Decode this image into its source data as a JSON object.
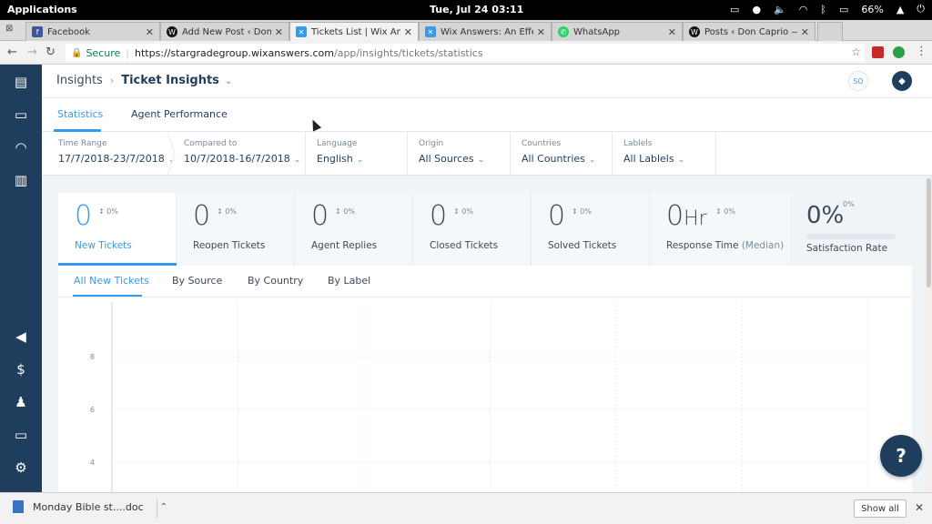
{
  "os": {
    "apps_label": "Applications",
    "clock": "Tue, Jul 24   03:11",
    "battery": "66%"
  },
  "browser": {
    "tabs": [
      {
        "title": "Facebook",
        "icon": "facebook-icon",
        "color": "#3b5998"
      },
      {
        "title": "Add New Post ‹ Don Cap",
        "icon": "wordpress-icon",
        "color": "#111111"
      },
      {
        "title": "Tickets List | Wix Answe",
        "icon": "wix-answers-icon",
        "color": "#3899ec"
      },
      {
        "title": "Wix Answers: An Effecti",
        "icon": "wix-answers-icon",
        "color": "#3899ec"
      },
      {
        "title": "WhatsApp",
        "icon": "whatsapp-icon",
        "color": "#25d366"
      },
      {
        "title": "Posts ‹ Don Caprio — W",
        "icon": "wordpress-icon",
        "color": "#111111"
      }
    ],
    "secure_label": "Secure",
    "url_host": "https://stargradegroup.wixanswers.com",
    "url_path": "/app/insights/tickets/statistics"
  },
  "header": {
    "breadcrumb_root": "Insights",
    "breadcrumb_current": "Ticket Insights",
    "avatar_initials": "SO"
  },
  "tabs": {
    "statistics": "Statistics",
    "agent_performance": "Agent Performance"
  },
  "filters": [
    {
      "label": "Time Range",
      "value": "17/7/2018-23/7/2018"
    },
    {
      "label": "Compared to",
      "value": "10/7/2018-16/7/2018"
    },
    {
      "label": "Language",
      "value": "English"
    },
    {
      "label": "Origin",
      "value": "All Sources"
    },
    {
      "label": "Countries",
      "value": "All Countries"
    },
    {
      "label": "Lablels",
      "value": "All Lablels"
    }
  ],
  "stats": [
    {
      "value": "0",
      "unit": "",
      "change": "0%",
      "label": "New Tickets",
      "sub": ""
    },
    {
      "value": "0",
      "unit": "",
      "change": "0%",
      "label": "Reopen Tickets",
      "sub": ""
    },
    {
      "value": "0",
      "unit": "",
      "change": "0%",
      "label": "Agent Replies",
      "sub": ""
    },
    {
      "value": "0",
      "unit": "",
      "change": "0%",
      "label": "Closed Tickets",
      "sub": ""
    },
    {
      "value": "0",
      "unit": "",
      "change": "0%",
      "label": "Solved Tickets",
      "sub": ""
    },
    {
      "value": "0",
      "unit": "Hr",
      "change": "0%",
      "label": "Response Time",
      "sub": "(Median)"
    }
  ],
  "satisfaction": {
    "value": "0%",
    "change": "0%",
    "label": "Satisfaction Rate",
    "fill_fraction": 0
  },
  "chart_tabs": [
    "All New Tickets",
    "By Source",
    "By Country",
    "By Label"
  ],
  "chart_data": {
    "type": "line",
    "title": "",
    "yticks_visible": [
      8,
      6,
      4
    ],
    "series": []
  },
  "help_label": "?",
  "downloads": {
    "item": "Monday  Bible st....doc",
    "show_all": "Show all"
  },
  "colors": {
    "accent": "#3899ec",
    "sidebar": "#1f3d5c"
  }
}
